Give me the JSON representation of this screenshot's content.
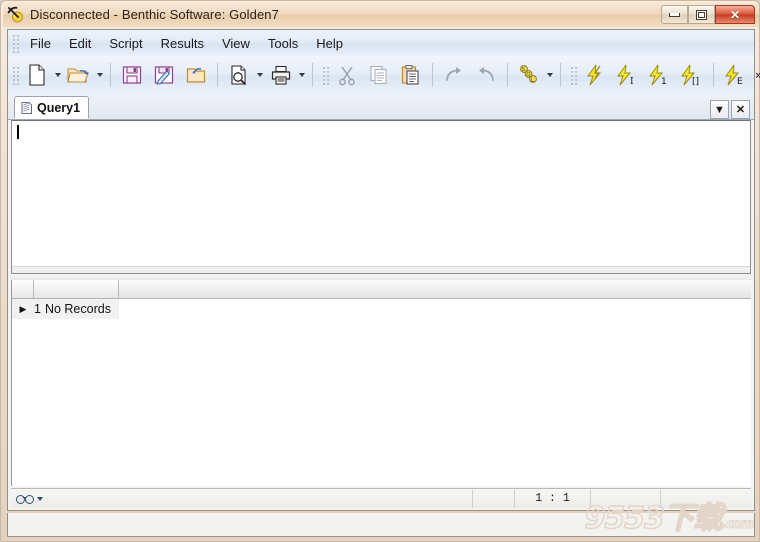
{
  "window": {
    "title": "Disconnected - Benthic Software: Golden7",
    "icon": "golden7-pickaxe-icon",
    "controls": {
      "minimize": "minimize-button",
      "restore": "restore-button",
      "close_label": "✕"
    },
    "colors": {
      "titlebar": "#f0d9bf",
      "close_button": "#d9543a",
      "menubar": "#e2eaf6",
      "toolbar": "#e6edf8",
      "editor_background": "#ffffff",
      "grid_row": "#f1f1f1",
      "statusbar": "#ececea",
      "watermark": "#e3d6c8"
    }
  },
  "menu": {
    "items": [
      {
        "label": "File"
      },
      {
        "label": "Edit"
      },
      {
        "label": "Script"
      },
      {
        "label": "Results"
      },
      {
        "label": "View"
      },
      {
        "label": "Tools"
      },
      {
        "label": "Help"
      }
    ]
  },
  "toolbar": {
    "buttons": [
      {
        "name": "new-file-button",
        "icon": "new-document-icon",
        "dropdown": true
      },
      {
        "name": "open-file-button",
        "icon": "open-folder-icon",
        "dropdown": true
      },
      {
        "name": "save-button",
        "icon": "floppy-save-icon",
        "dropdown": false
      },
      {
        "name": "save-as-button",
        "icon": "floppy-save-as-icon",
        "dropdown": false
      },
      {
        "name": "revert-button",
        "icon": "folder-revert-icon",
        "dropdown": false
      },
      {
        "name": "print-preview-button",
        "icon": "print-preview-icon",
        "dropdown": true
      },
      {
        "name": "print-button",
        "icon": "printer-icon",
        "dropdown": true
      },
      {
        "name": "cut-button",
        "icon": "scissors-icon",
        "dropdown": false
      },
      {
        "name": "copy-button",
        "icon": "copy-pages-icon",
        "dropdown": false
      },
      {
        "name": "paste-button",
        "icon": "clipboard-paste-icon",
        "dropdown": false
      },
      {
        "name": "redo-button",
        "icon": "redo-arrow-icon",
        "dropdown": false
      },
      {
        "name": "undo-button",
        "icon": "undo-arrow-icon",
        "dropdown": false
      },
      {
        "name": "sql-button",
        "icon": "sql-icon",
        "dropdown": true
      },
      {
        "name": "execute-button",
        "icon": "lightning-icon",
        "subscript": ""
      },
      {
        "name": "execute-immediate-button",
        "icon": "lightning-icon",
        "subscript": "I"
      },
      {
        "name": "execute-one-button",
        "icon": "lightning-icon",
        "subscript": "1"
      },
      {
        "name": "execute-block-button",
        "icon": "lightning-icon",
        "subscript": "[]"
      },
      {
        "name": "execute-explain-button",
        "icon": "lightning-icon",
        "subscript": "E"
      },
      {
        "name": "database-tools-button",
        "icon": "database-tools-icon",
        "dropdown": false
      }
    ],
    "overflow_label": "»"
  },
  "tabs": {
    "items": [
      {
        "label": "Query1",
        "icon": "query-script-icon",
        "active": true
      }
    ],
    "dropdown_label": "▼",
    "close_label": "✕"
  },
  "editor": {
    "content": "",
    "caret": "text-caret"
  },
  "results": {
    "header_columns": [
      "",
      ""
    ],
    "rows": [
      {
        "indicator": "▶",
        "number": "1",
        "text": "No Records"
      }
    ]
  },
  "statusbar": {
    "view_icon": "glasses-icon",
    "view_dropdown": "▼",
    "segments": [
      "",
      "",
      "1 : 1",
      "",
      ""
    ],
    "position": "1 : 1"
  },
  "watermark": {
    "text": "9553下载",
    "domain": ".com"
  }
}
